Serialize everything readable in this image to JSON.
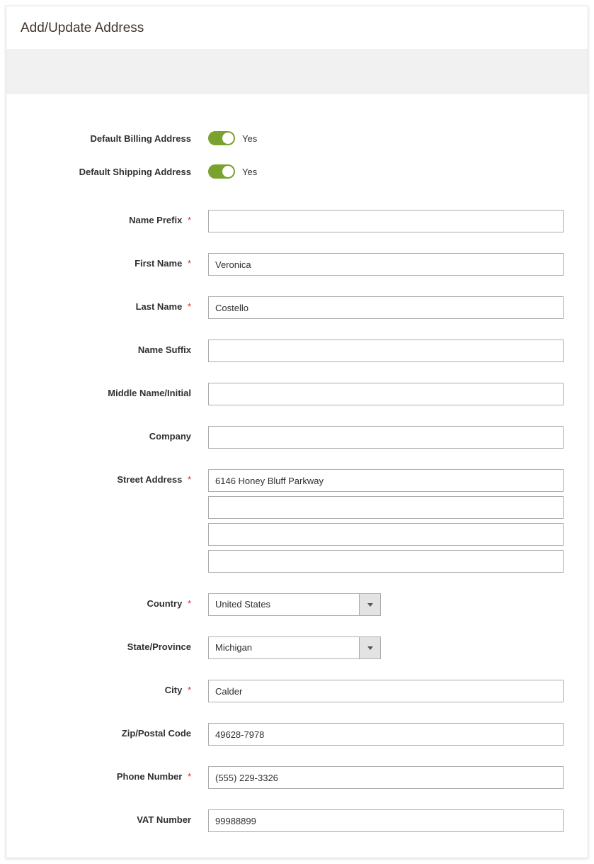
{
  "page": {
    "title": "Add/Update Address"
  },
  "toggles": {
    "default_billing": {
      "label": "Default Billing Address",
      "state_label": "Yes",
      "on": true
    },
    "default_shipping": {
      "label": "Default Shipping Address",
      "state_label": "Yes",
      "on": true
    }
  },
  "fields": {
    "name_prefix": {
      "label": "Name Prefix",
      "value": "",
      "required": true
    },
    "first_name": {
      "label": "First Name",
      "value": "Veronica",
      "required": true
    },
    "last_name": {
      "label": "Last Name",
      "value": "Costello",
      "required": true
    },
    "name_suffix": {
      "label": "Name Suffix",
      "value": "",
      "required": false
    },
    "middle_name": {
      "label": "Middle Name/Initial",
      "value": "",
      "required": false
    },
    "company": {
      "label": "Company",
      "value": "",
      "required": false
    },
    "street": {
      "label": "Street Address",
      "required": true,
      "lines": [
        "6146 Honey Bluff Parkway",
        "",
        "",
        ""
      ]
    },
    "country": {
      "label": "Country",
      "value": "United States",
      "required": true
    },
    "state": {
      "label": "State/Province",
      "value": "Michigan",
      "required": false
    },
    "city": {
      "label": "City",
      "value": "Calder",
      "required": true
    },
    "zip": {
      "label": "Zip/Postal Code",
      "value": "49628-7978",
      "required": false
    },
    "phone": {
      "label": "Phone Number",
      "value": "(555) 229-3326",
      "required": true
    },
    "vat": {
      "label": "VAT Number",
      "value": "99988899",
      "required": false
    }
  },
  "required_marker": "*"
}
